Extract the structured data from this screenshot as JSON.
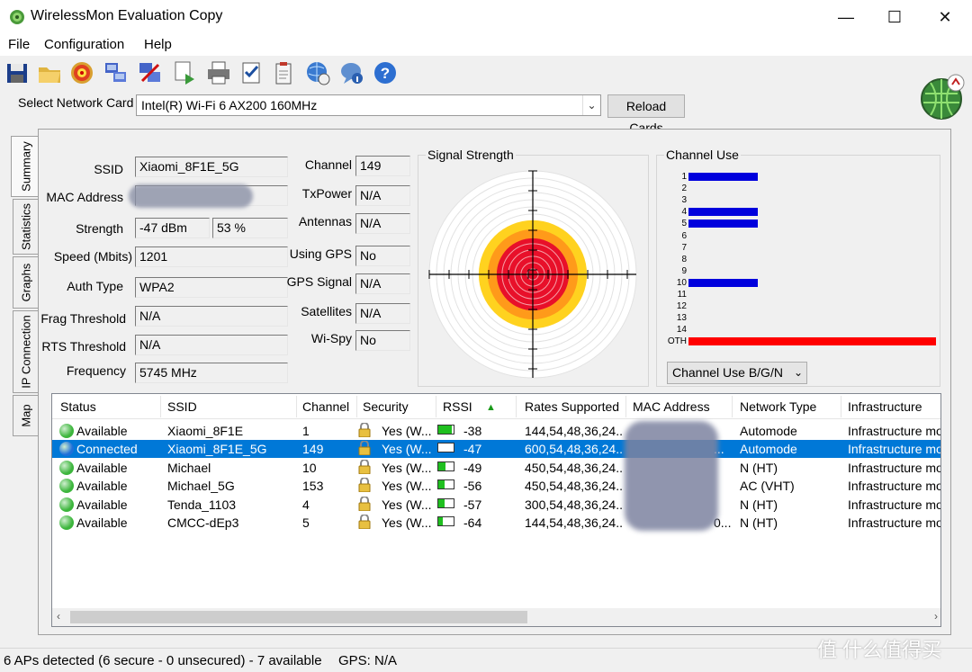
{
  "window": {
    "title": "WirelessMon Evaluation Copy",
    "minimize": "—",
    "maximize": "☐",
    "close": "✕"
  },
  "menu": [
    "File",
    "Configuration",
    "Help"
  ],
  "toolbar": {
    "icons": [
      "save-icon",
      "open-folder-icon",
      "target-icon",
      "network-cards-icon",
      "network-stop-icon",
      "print-preview-icon",
      "print-icon",
      "checklist-icon",
      "clipboard-icon",
      "web-globe-icon",
      "chat-info-icon",
      "help-icon"
    ]
  },
  "card": {
    "label": "Select Network Card",
    "value": "Intel(R) Wi-Fi 6 AX200 160MHz",
    "reload": "Reload Cards"
  },
  "tabs": [
    "Summary",
    "Statistics",
    "Graphs",
    "IP Connection",
    "Map"
  ],
  "summary": {
    "ssid_label": "SSID",
    "ssid": "Xiaomi_8F1E_5G",
    "mac_label": "MAC Address",
    "mac": "",
    "strength_label": "Strength",
    "strength_dbm": "-47 dBm",
    "strength_pct": "53 %",
    "speed_label": "Speed (Mbits)",
    "speed": "1201",
    "auth_label": "Auth Type",
    "auth": "WPA2",
    "frag_label": "Frag Threshold",
    "frag": "N/A",
    "rts_label": "RTS Threshold",
    "rts": "N/A",
    "freq_label": "Frequency",
    "freq": "5745 MHz",
    "channel_label": "Channel",
    "channel": "149",
    "txpower_label": "TxPower",
    "txpower": "N/A",
    "antennas_label": "Antennas",
    "antennas": "N/A",
    "gps_label": "Using GPS",
    "gps": "No",
    "gps_signal_label": "GPS Signal",
    "gps_signal": "N/A",
    "satellites_label": "Satellites",
    "satellites": "N/A",
    "wispy_label": "Wi-Spy",
    "wispy": "No"
  },
  "signal": {
    "title": "Signal Strength",
    "strength_fraction": 0.53
  },
  "channel_use": {
    "title": "Channel Use",
    "channels": [
      {
        "label": "1",
        "use": 0.28,
        "color": "#0000dd"
      },
      {
        "label": "2",
        "use": 0,
        "color": "#0000dd"
      },
      {
        "label": "3",
        "use": 0,
        "color": "#0000dd"
      },
      {
        "label": "4",
        "use": 0.28,
        "color": "#0000dd"
      },
      {
        "label": "5",
        "use": 0.28,
        "color": "#0000dd"
      },
      {
        "label": "6",
        "use": 0,
        "color": "#0000dd"
      },
      {
        "label": "7",
        "use": 0,
        "color": "#0000dd"
      },
      {
        "label": "8",
        "use": 0,
        "color": "#0000dd"
      },
      {
        "label": "9",
        "use": 0,
        "color": "#0000dd"
      },
      {
        "label": "10",
        "use": 0.28,
        "color": "#0000dd"
      },
      {
        "label": "11",
        "use": 0,
        "color": "#0000dd"
      },
      {
        "label": "12",
        "use": 0,
        "color": "#0000dd"
      },
      {
        "label": "13",
        "use": 0,
        "color": "#0000dd"
      },
      {
        "label": "14",
        "use": 0,
        "color": "#0000dd"
      },
      {
        "label": "OTH",
        "use": 1.0,
        "color": "#ff0000"
      }
    ],
    "selector": "Channel Use B/G/N"
  },
  "list": {
    "columns": [
      "Status",
      "SSID",
      "Channel",
      "Security",
      "RSSI",
      "Rates Supported",
      "MAC Address",
      "Network Type",
      "Infrastructure"
    ],
    "rows": [
      {
        "status": "Available",
        "ssid": "Xiaomi_8F1E",
        "channel": "1",
        "security": "Yes (W...",
        "rssi": "-38",
        "rssi_fill": 0.9,
        "rates": "144,54,48,36,24...",
        "mac_tail": "",
        "type": "Automode",
        "infra": "Infrastructure mo...",
        "selected": false
      },
      {
        "status": "Connected",
        "ssid": "Xiaomi_8F1E_5G",
        "channel": "149",
        "security": "Yes (W...",
        "rssi": "-47",
        "rssi_fill": 0.0,
        "rates": "600,54,48,36,24...",
        "mac_tail": "...",
        "type": "Automode",
        "infra": "Infrastructure mo...",
        "selected": true
      },
      {
        "status": "Available",
        "ssid": "Michael",
        "channel": "10",
        "security": "Yes (W...",
        "rssi": "-49",
        "rssi_fill": 0.45,
        "rates": "450,54,48,36,24...",
        "mac_tail": "",
        "type": "N (HT)",
        "infra": "Infrastructure mo...",
        "selected": false
      },
      {
        "status": "Available",
        "ssid": "Michael_5G",
        "channel": "153",
        "security": "Yes (W...",
        "rssi": "-56",
        "rssi_fill": 0.4,
        "rates": "450,54,48,36,24...",
        "mac_tail": "",
        "type": "AC (VHT)",
        "infra": "Infrastructure mo...",
        "selected": false
      },
      {
        "status": "Available",
        "ssid": "Tenda_1103",
        "channel": "4",
        "security": "Yes (W...",
        "rssi": "-57",
        "rssi_fill": 0.4,
        "rates": "300,54,48,36,24...",
        "mac_tail": "",
        "type": "N (HT)",
        "infra": "Infrastructure mo...",
        "selected": false
      },
      {
        "status": "Available",
        "ssid": "CMCC-dEp3",
        "channel": "5",
        "security": "Yes (W...",
        "rssi": "-64",
        "rssi_fill": 0.3,
        "rates": "144,54,48,36,24...",
        "mac_tail": "0...",
        "type": "N (HT)",
        "infra": "Infrastructure mo...",
        "selected": false
      }
    ]
  },
  "statusbar": {
    "aps": "6 APs detected (6 secure - 0 unsecured) - 7 available",
    "gps": "GPS: N/A",
    "watermark": "值 什么值得买"
  },
  "colors": {
    "selected": "#0078d7",
    "available": "#3cb53c",
    "connected": "#1e6fd9"
  }
}
